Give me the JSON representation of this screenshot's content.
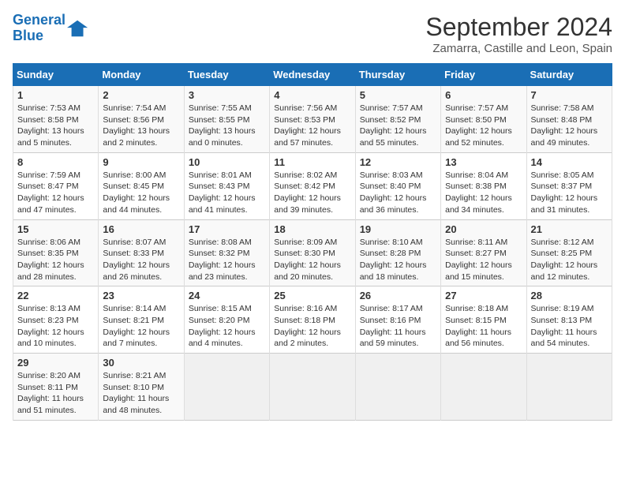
{
  "logo": {
    "line1": "General",
    "line2": "Blue"
  },
  "title": "September 2024",
  "subtitle": "Zamarra, Castille and Leon, Spain",
  "weekdays": [
    "Sunday",
    "Monday",
    "Tuesday",
    "Wednesday",
    "Thursday",
    "Friday",
    "Saturday"
  ],
  "weeks": [
    [
      {
        "day": "1",
        "lines": [
          "Sunrise: 7:53 AM",
          "Sunset: 8:58 PM",
          "Daylight: 13 hours",
          "and 5 minutes."
        ]
      },
      {
        "day": "2",
        "lines": [
          "Sunrise: 7:54 AM",
          "Sunset: 8:56 PM",
          "Daylight: 13 hours",
          "and 2 minutes."
        ]
      },
      {
        "day": "3",
        "lines": [
          "Sunrise: 7:55 AM",
          "Sunset: 8:55 PM",
          "Daylight: 13 hours",
          "and 0 minutes."
        ]
      },
      {
        "day": "4",
        "lines": [
          "Sunrise: 7:56 AM",
          "Sunset: 8:53 PM",
          "Daylight: 12 hours",
          "and 57 minutes."
        ]
      },
      {
        "day": "5",
        "lines": [
          "Sunrise: 7:57 AM",
          "Sunset: 8:52 PM",
          "Daylight: 12 hours",
          "and 55 minutes."
        ]
      },
      {
        "day": "6",
        "lines": [
          "Sunrise: 7:57 AM",
          "Sunset: 8:50 PM",
          "Daylight: 12 hours",
          "and 52 minutes."
        ]
      },
      {
        "day": "7",
        "lines": [
          "Sunrise: 7:58 AM",
          "Sunset: 8:48 PM",
          "Daylight: 12 hours",
          "and 49 minutes."
        ]
      }
    ],
    [
      {
        "day": "8",
        "lines": [
          "Sunrise: 7:59 AM",
          "Sunset: 8:47 PM",
          "Daylight: 12 hours",
          "and 47 minutes."
        ]
      },
      {
        "day": "9",
        "lines": [
          "Sunrise: 8:00 AM",
          "Sunset: 8:45 PM",
          "Daylight: 12 hours",
          "and 44 minutes."
        ]
      },
      {
        "day": "10",
        "lines": [
          "Sunrise: 8:01 AM",
          "Sunset: 8:43 PM",
          "Daylight: 12 hours",
          "and 41 minutes."
        ]
      },
      {
        "day": "11",
        "lines": [
          "Sunrise: 8:02 AM",
          "Sunset: 8:42 PM",
          "Daylight: 12 hours",
          "and 39 minutes."
        ]
      },
      {
        "day": "12",
        "lines": [
          "Sunrise: 8:03 AM",
          "Sunset: 8:40 PM",
          "Daylight: 12 hours",
          "and 36 minutes."
        ]
      },
      {
        "day": "13",
        "lines": [
          "Sunrise: 8:04 AM",
          "Sunset: 8:38 PM",
          "Daylight: 12 hours",
          "and 34 minutes."
        ]
      },
      {
        "day": "14",
        "lines": [
          "Sunrise: 8:05 AM",
          "Sunset: 8:37 PM",
          "Daylight: 12 hours",
          "and 31 minutes."
        ]
      }
    ],
    [
      {
        "day": "15",
        "lines": [
          "Sunrise: 8:06 AM",
          "Sunset: 8:35 PM",
          "Daylight: 12 hours",
          "and 28 minutes."
        ]
      },
      {
        "day": "16",
        "lines": [
          "Sunrise: 8:07 AM",
          "Sunset: 8:33 PM",
          "Daylight: 12 hours",
          "and 26 minutes."
        ]
      },
      {
        "day": "17",
        "lines": [
          "Sunrise: 8:08 AM",
          "Sunset: 8:32 PM",
          "Daylight: 12 hours",
          "and 23 minutes."
        ]
      },
      {
        "day": "18",
        "lines": [
          "Sunrise: 8:09 AM",
          "Sunset: 8:30 PM",
          "Daylight: 12 hours",
          "and 20 minutes."
        ]
      },
      {
        "day": "19",
        "lines": [
          "Sunrise: 8:10 AM",
          "Sunset: 8:28 PM",
          "Daylight: 12 hours",
          "and 18 minutes."
        ]
      },
      {
        "day": "20",
        "lines": [
          "Sunrise: 8:11 AM",
          "Sunset: 8:27 PM",
          "Daylight: 12 hours",
          "and 15 minutes."
        ]
      },
      {
        "day": "21",
        "lines": [
          "Sunrise: 8:12 AM",
          "Sunset: 8:25 PM",
          "Daylight: 12 hours",
          "and 12 minutes."
        ]
      }
    ],
    [
      {
        "day": "22",
        "lines": [
          "Sunrise: 8:13 AM",
          "Sunset: 8:23 PM",
          "Daylight: 12 hours",
          "and 10 minutes."
        ]
      },
      {
        "day": "23",
        "lines": [
          "Sunrise: 8:14 AM",
          "Sunset: 8:21 PM",
          "Daylight: 12 hours",
          "and 7 minutes."
        ]
      },
      {
        "day": "24",
        "lines": [
          "Sunrise: 8:15 AM",
          "Sunset: 8:20 PM",
          "Daylight: 12 hours",
          "and 4 minutes."
        ]
      },
      {
        "day": "25",
        "lines": [
          "Sunrise: 8:16 AM",
          "Sunset: 8:18 PM",
          "Daylight: 12 hours",
          "and 2 minutes."
        ]
      },
      {
        "day": "26",
        "lines": [
          "Sunrise: 8:17 AM",
          "Sunset: 8:16 PM",
          "Daylight: 11 hours",
          "and 59 minutes."
        ]
      },
      {
        "day": "27",
        "lines": [
          "Sunrise: 8:18 AM",
          "Sunset: 8:15 PM",
          "Daylight: 11 hours",
          "and 56 minutes."
        ]
      },
      {
        "day": "28",
        "lines": [
          "Sunrise: 8:19 AM",
          "Sunset: 8:13 PM",
          "Daylight: 11 hours",
          "and 54 minutes."
        ]
      }
    ],
    [
      {
        "day": "29",
        "lines": [
          "Sunrise: 8:20 AM",
          "Sunset: 8:11 PM",
          "Daylight: 11 hours",
          "and 51 minutes."
        ]
      },
      {
        "day": "30",
        "lines": [
          "Sunrise: 8:21 AM",
          "Sunset: 8:10 PM",
          "Daylight: 11 hours",
          "and 48 minutes."
        ]
      },
      {
        "day": "",
        "lines": []
      },
      {
        "day": "",
        "lines": []
      },
      {
        "day": "",
        "lines": []
      },
      {
        "day": "",
        "lines": []
      },
      {
        "day": "",
        "lines": []
      }
    ]
  ]
}
